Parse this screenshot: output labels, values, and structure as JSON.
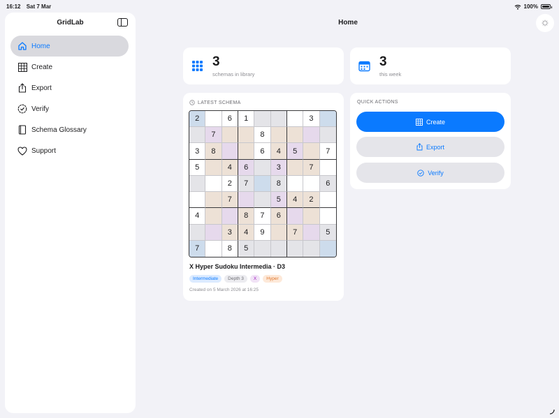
{
  "status_bar": {
    "time": "16:12",
    "date": "Sat 7 Mar",
    "battery": "100%"
  },
  "sidebar": {
    "title": "GridLab",
    "items": [
      {
        "label": "Home",
        "icon": "house-icon",
        "active": true
      },
      {
        "label": "Create",
        "icon": "grid-icon",
        "active": false
      },
      {
        "label": "Export",
        "icon": "share-icon",
        "active": false
      },
      {
        "label": "Verify",
        "icon": "checkmark-seal-icon",
        "active": false
      },
      {
        "label": "Schema Glossary",
        "icon": "book-icon",
        "active": false
      },
      {
        "label": "Support",
        "icon": "heart-icon",
        "active": false
      }
    ]
  },
  "header": {
    "title": "Home"
  },
  "stats": [
    {
      "value": "3",
      "label": "schemas in library",
      "icon": "grid-dots-icon"
    },
    {
      "value": "3",
      "label": "this week",
      "icon": "calendar-icon"
    }
  ],
  "latest_schema": {
    "section_title": "LATEST SCHEMA",
    "name": "X Hyper Sudoku Intermedia · D3",
    "tags": [
      {
        "label": "Intermediate",
        "tone": "blue"
      },
      {
        "label": "Depth 3",
        "tone": "gray"
      },
      {
        "label": "X",
        "tone": "purple"
      },
      {
        "label": "Hyper",
        "tone": "orange"
      }
    ],
    "created": "Created on 5 March 2026 at 16:25",
    "grid": [
      [
        "2",
        "",
        "6",
        "1",
        "",
        "",
        "",
        "3",
        ""
      ],
      [
        "",
        "7",
        "",
        "",
        "8",
        "",
        "",
        "",
        ""
      ],
      [
        "3",
        "8",
        "",
        "",
        "6",
        "4",
        "5",
        "",
        "7"
      ],
      [
        "5",
        "",
        "4",
        "6",
        "",
        "3",
        "",
        "7",
        ""
      ],
      [
        "",
        "",
        "2",
        "7",
        "",
        "8",
        "",
        "",
        "6"
      ],
      [
        "",
        "",
        "7",
        "",
        "",
        "5",
        "4",
        "2",
        ""
      ],
      [
        "4",
        "",
        "",
        "8",
        "7",
        "6",
        "",
        "",
        ""
      ],
      [
        "",
        "",
        "3",
        "4",
        "9",
        "",
        "7",
        "",
        "5"
      ],
      [
        "7",
        "",
        "8",
        "5",
        "",
        "",
        "",
        "",
        ""
      ]
    ],
    "shading": [
      [
        "b",
        "w",
        "w",
        "w",
        "g",
        "g",
        "w",
        "w",
        "b"
      ],
      [
        "g",
        "p",
        "t",
        "t",
        "w",
        "t",
        "t",
        "p",
        "g"
      ],
      [
        "w",
        "t",
        "p",
        "t",
        "w",
        "t",
        "p",
        "t",
        "w"
      ],
      [
        "w",
        "t",
        "t",
        "p",
        "g",
        "p",
        "t",
        "t",
        "w"
      ],
      [
        "g",
        "w",
        "w",
        "g",
        "b",
        "g",
        "w",
        "w",
        "g"
      ],
      [
        "w",
        "t",
        "t",
        "p",
        "g",
        "p",
        "t",
        "t",
        "w"
      ],
      [
        "w",
        "t",
        "p",
        "t",
        "w",
        "t",
        "p",
        "t",
        "w"
      ],
      [
        "g",
        "p",
        "t",
        "t",
        "w",
        "t",
        "t",
        "p",
        "g"
      ],
      [
        "b",
        "w",
        "w",
        "g",
        "g",
        "g",
        "g",
        "g",
        "b"
      ]
    ],
    "palette": {
      "w": "#ffffff",
      "g": "#e4e4e8",
      "t": "#ede1d6",
      "p": "#e6d9ec",
      "b": "#cddcec"
    }
  },
  "quick_actions": {
    "section_title": "QUICK ACTIONS",
    "buttons": [
      {
        "label": "Create",
        "icon": "grid-icon",
        "style": "primary"
      },
      {
        "label": "Export",
        "icon": "share-icon",
        "style": "secondary"
      },
      {
        "label": "Verify",
        "icon": "checkmark-circle-icon",
        "style": "secondary"
      }
    ]
  },
  "colors": {
    "accent": "#0a7aff",
    "background": "#f2f2f7",
    "card": "#ffffff"
  }
}
